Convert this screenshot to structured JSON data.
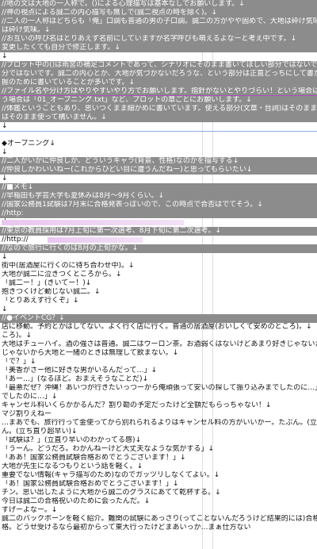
{
  "editor": {
    "lines": [
      {
        "t": "//地の文は大地の一人称で。()による心理描写は基本なしでお願いします。↓",
        "c": true
      },
      {
        "t": "//神の視点による誠二の内心描写も無しで(誠二視点の時を除く)。↓",
        "c": true
      },
      {
        "t": "//二人の一人称はどちらも「俺」口調も普通の男の子口調。誠二の方がやや固めで、大地は砕け気味。↓",
        "c": true
      },
      {
        "t": "は砕け気味。↓",
        "c": true
      },
      {
        "t": "//お互いの呼び名はとりあえず名前にしていますが名字呼びも萌えるよなーと考え中です。↓",
        "c": true
      },
      {
        "t": "変更したくても自分で修正します。↓",
        "c": true
      },
      {
        "t": "↓",
        "c": false
      },
      {
        "t": "//プロット中の()は雨宮の補足コメントであって、シナリオにそのまま書いてほしい部分ではないです。誠二の内心とか、大地が気づかないだろうな、という部分は正直どっちにして書かなくて構いません。声優さんの演技や、ライターさんのキャラ・状況把握のために書いていることが多いです。↓",
        "c": true
      },
      {
        "t": "分ではないです。誠二の内心とか、大地が気づかないだろうな、という部分は正直どっちにして書かなくて構いません。声優さんの演技や、ライターさんのキャラ・状況把握のために書いていることが多いです。↓",
        "c": true
      },
      {
        "t": "握のために書いていることが多いです。↓",
        "c": true
      },
      {
        "t": "//ファイル名や分け方はやりやすいやり方でお願いします。指針がないとやりづらい！という場合は「01_オープニング.txt」など、プロットの章ごとにお願いします。↓",
        "c": true,
        "purple": true
      },
      {
        "t": "う場合は「01_オープニング.txt」など、プロットの章ごとにお願いします。↓",
        "c": true
      },
      {
        "t": "//体鑑ということもあり、思いつくまま細かめに書いています。使える部分(文章・台詞)はそのまま使って構いません。↓",
        "c": true
      },
      {
        "t": "はそのまま使って構いません。↓",
        "c": true
      },
      {
        "t": "↓",
        "c": false
      },
      {
        "t": "",
        "c": false,
        "sep": true
      },
      {
        "t": "◆オープニング↓",
        "c": false
      },
      {
        "t": "↓",
        "c": false
      },
      {
        "t": "//二人がいかに仲良しか、どういうキャラ(背景、性格)なのかを描写する↓",
        "c": true
      },
      {
        "t": "//仲良しかわいいねー(これからひどい目に遭うんだねー)と思ってもらいたい↓",
        "c": true
      },
      {
        "t": "↓",
        "c": false
      },
      {
        "t": "//■メモ↓",
        "c": true
      },
      {
        "t": "//早稲田も学芸大学も夏休みは8月～9月くらい。↓",
        "c": true
      },
      {
        "t": "//国家公務員1試験は7月末に合格発表っぽいので、この時点で合否はでてそう。↓",
        "c": true
      },
      {
        "t": "//http:",
        "c": true
      },
      {
        "t": "do_soug",
        "c": false,
        "hl": true,
        "hlw": "230px"
      },
      {
        "t": "//東京の教員採用は7月上旬に第一次選考、8月下旬に第二次選考。↓",
        "c": true
      },
      {
        "t": "//http://",
        "c": false,
        "hl2": true
      },
      {
        "t": "//なので旅行に行くのは8月の上旬かな。↓",
        "c": true
      },
      {
        "t": "↓",
        "c": false
      },
      {
        "t": "街中(居酒屋に行くのに待ち合わせ中)。↓",
        "c": false
      },
      {
        "t": "大地が誠二に泣きつくところから。↓",
        "c": false
      },
      {
        "t": "「誠二ー！」(きいてー！)↓",
        "c": false
      },
      {
        "t": "抱きつくけど動じない誠二。↓",
        "c": false
      },
      {
        "t": "「とりあえず行くぞ」↓",
        "c": false
      },
      {
        "t": "↓",
        "c": false
      },
      {
        "t": "//●イベントCG？↓",
        "c": true
      },
      {
        "t": "店に移動。予約とかはしてない。よく行く店に行く。普通の居酒屋(おいしくて安めのところ)。↓",
        "c": false
      },
      {
        "t": "ころ)。↓",
        "c": false
      },
      {
        "t": "大地はチューハイ。酒の強さは普通。誠二はウーロン茶。お酒弱くはないけどあまり好きじゃないから大地と一緒のときは無理して飲まない。↓",
        "c": false
      },
      {
        "t": "じゃないから大地と一緒のときは無理して飲まない。↓",
        "c": false
      },
      {
        "t": "「で？」↓",
        "c": false
      },
      {
        "t": "「美香がさー他に好きな男がいるんだって…」↓",
        "c": false
      },
      {
        "t": "「あー…」(なるほど。おまえそうなことだ)↓",
        "c": false
      },
      {
        "t": "「最悪だぜ？沖縄！あいつが行きたいっつーから俺頑張って安いの探して振り込みまでしたのに…」↓",
        "c": false
      },
      {
        "t": "でしたのに…」↓",
        "c": false
      },
      {
        "t": "キャンセル料いくらかかるんだ？割り勘の予定だったけど全額だもらっちゃない！↓",
        "c": false
      },
      {
        "t": "マジ割りえねー",
        "c": false
      },
      {
        "t": "…まあでも、旅行行って金使ってから別れられるよりはキャンセル料の方がいいかー。たぶん。(立ち直り超早い)↓",
        "c": false
      },
      {
        "t": "ん。(立ち直り超早い)↓",
        "c": false
      },
      {
        "t": "「試験は？」(立直り早いのわかってる感)↓",
        "c": false
      },
      {
        "t": "「うーん。どうだろ。わかんねーけど大丈夫なような気がする」↓",
        "c": false
      },
      {
        "t": "「ああ！国家公務員試験合格おめでとうございます！」↓",
        "c": false
      },
      {
        "t": "大地が先生になるつもりという話を軽く。↓",
        "c": false
      },
      {
        "t": "重要でない情報(キャラ描写のため)なのでガッツリしなくてよい。↓",
        "c": false
      },
      {
        "t": "「あ！国家公務員試験合格おめでとうございます！」↓",
        "c": false
      },
      {
        "t": "チン。思い出したように大地から誠二のグラスにあてて乾杯する。↓",
        "c": false
      },
      {
        "t": "今日は誠二の合格祝いのために会ったんだ。↓",
        "c": false
      },
      {
        "t": "すげーよなー。↓",
        "c": false
      },
      {
        "t": "誠二のバックボーンを軽く紹介。難関の試験にあっさり(ってことないんだろうけど結果的には)合格。どうせ受けるなら最初からってことで東大行ったけどまあいっか。",
        "c": false
      },
      {
        "t": "格。どうせ受けるなら最初からって東大行ったけどまあいっか…まぁ仕方ない",
        "c": false
      }
    ]
  }
}
